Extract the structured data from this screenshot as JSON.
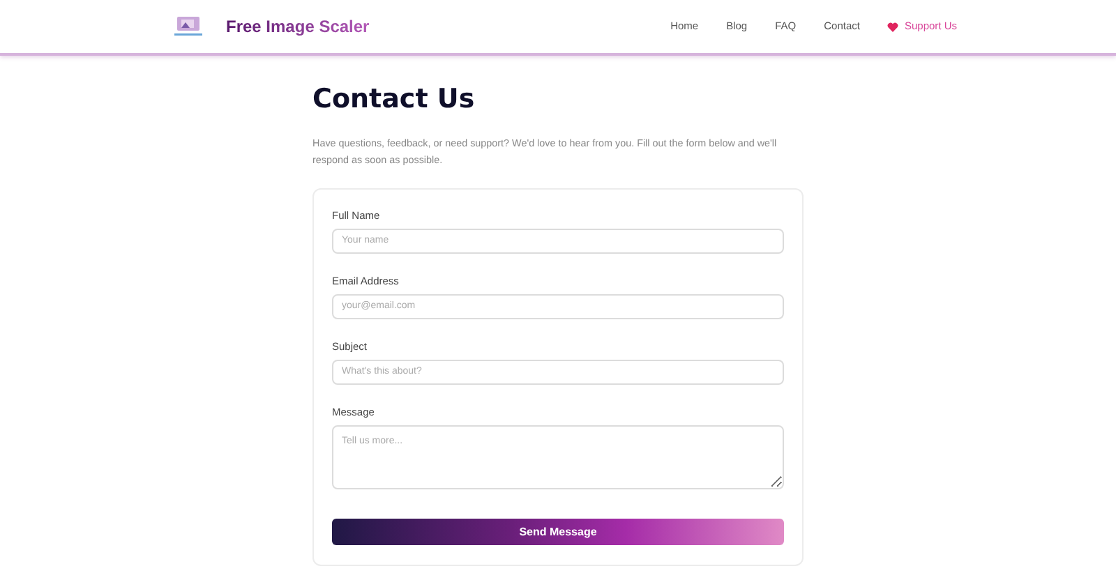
{
  "brand": {
    "name": "Free Image Scaler"
  },
  "nav": [
    {
      "label": "Home",
      "kind": "link"
    },
    {
      "label": "Blog",
      "kind": "link"
    },
    {
      "label": "FAQ",
      "kind": "link"
    },
    {
      "label": "Contact",
      "kind": "link"
    },
    {
      "label": "Support Us",
      "kind": "support"
    }
  ],
  "page": {
    "title": "Contact Us",
    "intro": "Have questions, feedback, or need support? We'd love to hear from you. Fill out the form below and we'll respond as soon as possible."
  },
  "form": {
    "fields": [
      {
        "label": "Full Name",
        "placeholder": "Your name",
        "kind": "text"
      },
      {
        "label": "Email Address",
        "placeholder": "your@email.com",
        "kind": "email"
      },
      {
        "label": "Subject",
        "placeholder": "What's this about?",
        "kind": "text"
      },
      {
        "label": "Message",
        "placeholder": "Tell us more...",
        "kind": "textarea"
      }
    ],
    "submit": "Send Message"
  }
}
